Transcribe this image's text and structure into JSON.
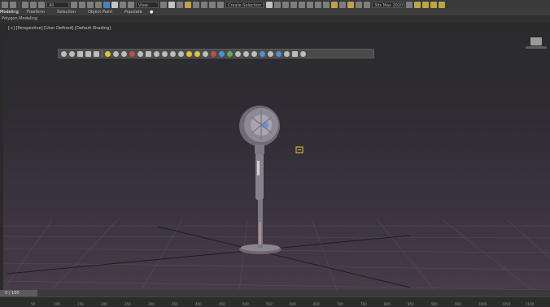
{
  "main_toolbar": {
    "selection_filter": "All",
    "reference_coord": "View",
    "named_selection": "Create Selection Se",
    "workspace": "Workspaces: Default",
    "max_version": "3ds Max 2020"
  },
  "ribbon": {
    "tabs": [
      "Modeling",
      "Freeform",
      "Selection",
      "Object Paint",
      "Populate"
    ],
    "active_tab": "Modeling"
  },
  "subbar": {
    "label": "Polygon Modeling"
  },
  "viewport": {
    "label": "[+] [Perspective] [User Defined] [Default Shading]"
  },
  "timeline": {
    "frame_label": "0 / 100"
  },
  "ruler": {
    "ticks": [
      "0",
      "50",
      "100",
      "150",
      "200",
      "250",
      "300",
      "350",
      "400",
      "450",
      "500",
      "550",
      "600",
      "650",
      "700",
      "750",
      "800",
      "850",
      "900",
      "950",
      "1000",
      "1050",
      "1100"
    ]
  }
}
